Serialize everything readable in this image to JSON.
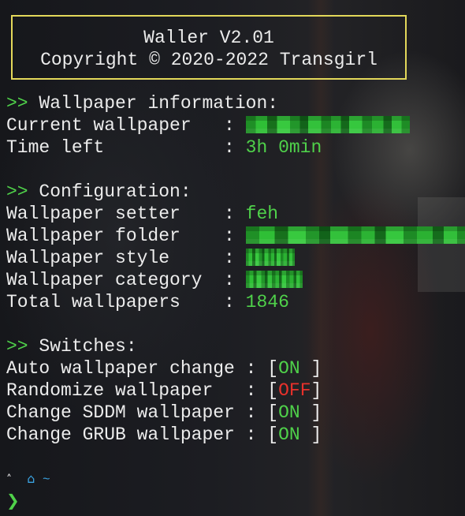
{
  "banner": {
    "title": "Waller V2.01",
    "copyright": "Copyright © 2020-2022 Transgirl"
  },
  "prefix": ">>",
  "sep": " : ",
  "info": {
    "heading": "Wallpaper information:",
    "current_label": "Current wallpaper  ",
    "time_label": "Time left          ",
    "time_value": "3h 0min"
  },
  "config": {
    "heading": "Configuration:",
    "setter_label": "Wallpaper setter   ",
    "setter_value": "feh",
    "folder_label": "Wallpaper folder   ",
    "style_label": "Wallpaper style    ",
    "category_label": "Wallpaper category ",
    "total_label": "Total wallpapers   ",
    "total_value": "1846"
  },
  "switches": {
    "heading": "Switches:",
    "items": [
      {
        "label": "Auto wallpaper change",
        "state": "ON ",
        "on": true
      },
      {
        "label": "Randomize wallpaper  ",
        "state": "OFF",
        "on": false
      },
      {
        "label": "Change SDDM wallpaper",
        "state": "ON ",
        "on": true
      },
      {
        "label": "Change GRUB wallpaper",
        "state": "ON ",
        "on": true
      }
    ]
  },
  "prompt": {
    "arch_icon": "arch-linux-icon",
    "home_icon": "home-icon",
    "dir": "~",
    "chevron": "❯"
  },
  "colors": {
    "accent_green": "#4fd14a",
    "off_red": "#e8312b",
    "banner_border": "#e3d85a",
    "path_blue": "#3aa2e0"
  }
}
